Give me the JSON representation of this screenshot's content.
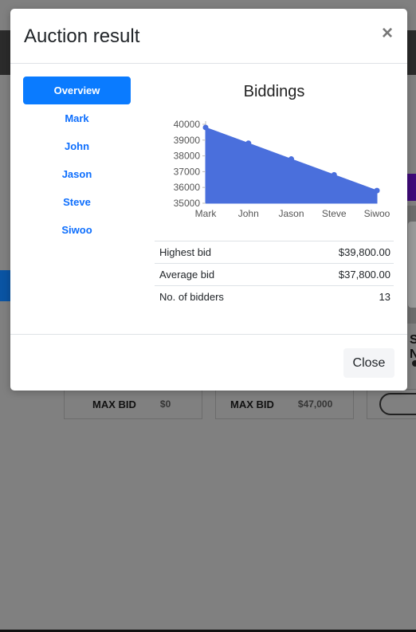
{
  "background": {
    "cards": [
      {
        "label": "MAX BID",
        "value": "$0"
      },
      {
        "label": "MAX BID",
        "value": "$47,000"
      }
    ],
    "peek_text": "S N"
  },
  "modal": {
    "title": "Auction result",
    "close_symbol": "×",
    "tabs": [
      "Overview",
      "Mark",
      "John",
      "Jason",
      "Steve",
      "Siwoo"
    ],
    "active_tab": "Overview",
    "close_button_label": "Close"
  },
  "chart_data": {
    "type": "area",
    "title": "Biddings",
    "categories": [
      "Mark",
      "John",
      "Jason",
      "Steve",
      "Siwoo"
    ],
    "values": [
      39800,
      38800,
      37800,
      36800,
      35800
    ],
    "yticks": [
      35000,
      36000,
      37000,
      38000,
      39000,
      40000
    ],
    "ylim": [
      35000,
      40000
    ],
    "color": "#4a6fdc",
    "grid": false,
    "legend": false
  },
  "stats": [
    {
      "label": "Highest bid",
      "value": "$39,800.00"
    },
    {
      "label": "Average bid",
      "value": "$37,800.00"
    },
    {
      "label": "No. of bidders",
      "value": "13"
    }
  ]
}
